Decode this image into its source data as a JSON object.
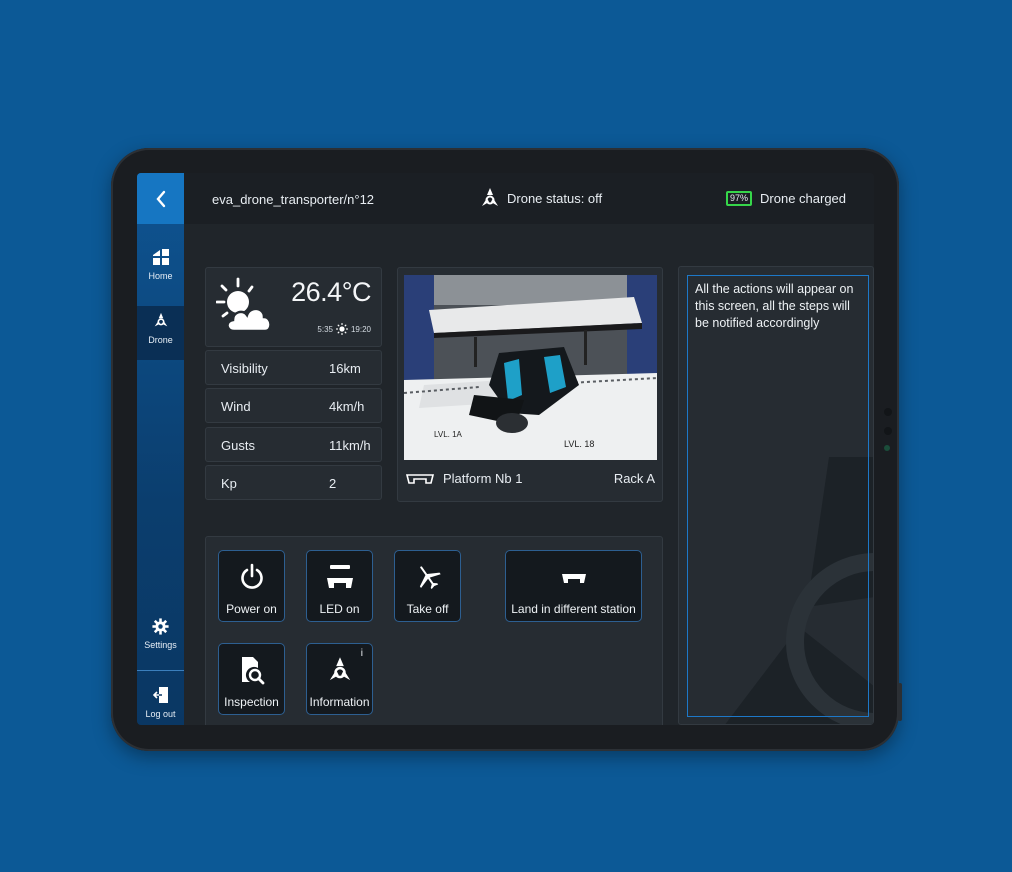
{
  "app": {
    "path": "eva_drone_transporter/n°12",
    "status_label": "Drone status: off",
    "battery_percent": "97%",
    "charged_label": "Drone charged"
  },
  "sidebar": {
    "items": [
      {
        "label": "Home",
        "icon": "home-icon"
      },
      {
        "label": "Drone",
        "icon": "drone-icon"
      },
      {
        "label": "Settings",
        "icon": "gear-icon"
      },
      {
        "label": "Log out",
        "icon": "logout-icon"
      }
    ]
  },
  "weather": {
    "temperature": "26.4°C",
    "sunrise": "5:35",
    "sunset": "19:20",
    "rows": [
      {
        "label": "Visibility",
        "value": "16km"
      },
      {
        "label": "Wind",
        "value": "4km/h"
      },
      {
        "label": "Gusts",
        "value": "11km/h"
      },
      {
        "label": "Kp",
        "value": "2"
      }
    ]
  },
  "camera": {
    "platform": "Platform Nb 1",
    "rack": "Rack A",
    "level_labels": [
      "LVL. 18",
      "LVL. 1A"
    ]
  },
  "log": {
    "message": "All the actions will appear on this screen, all the steps will be notified accordingly"
  },
  "actions": {
    "buttons": [
      {
        "label": "Power on",
        "icon": "power-icon"
      },
      {
        "label": "LED on",
        "icon": "led-icon"
      },
      {
        "label": "Take off",
        "icon": "airplane-icon"
      },
      {
        "label": "Land in different station",
        "icon": "platform-icon"
      },
      {
        "label": "Inspection",
        "icon": "inspection-icon"
      },
      {
        "label": "Information",
        "icon": "drone-icon",
        "badge": "i"
      }
    ]
  },
  "colors": {
    "background": "#0c5996",
    "accent": "#1676c2",
    "battery": "#36d64a"
  }
}
